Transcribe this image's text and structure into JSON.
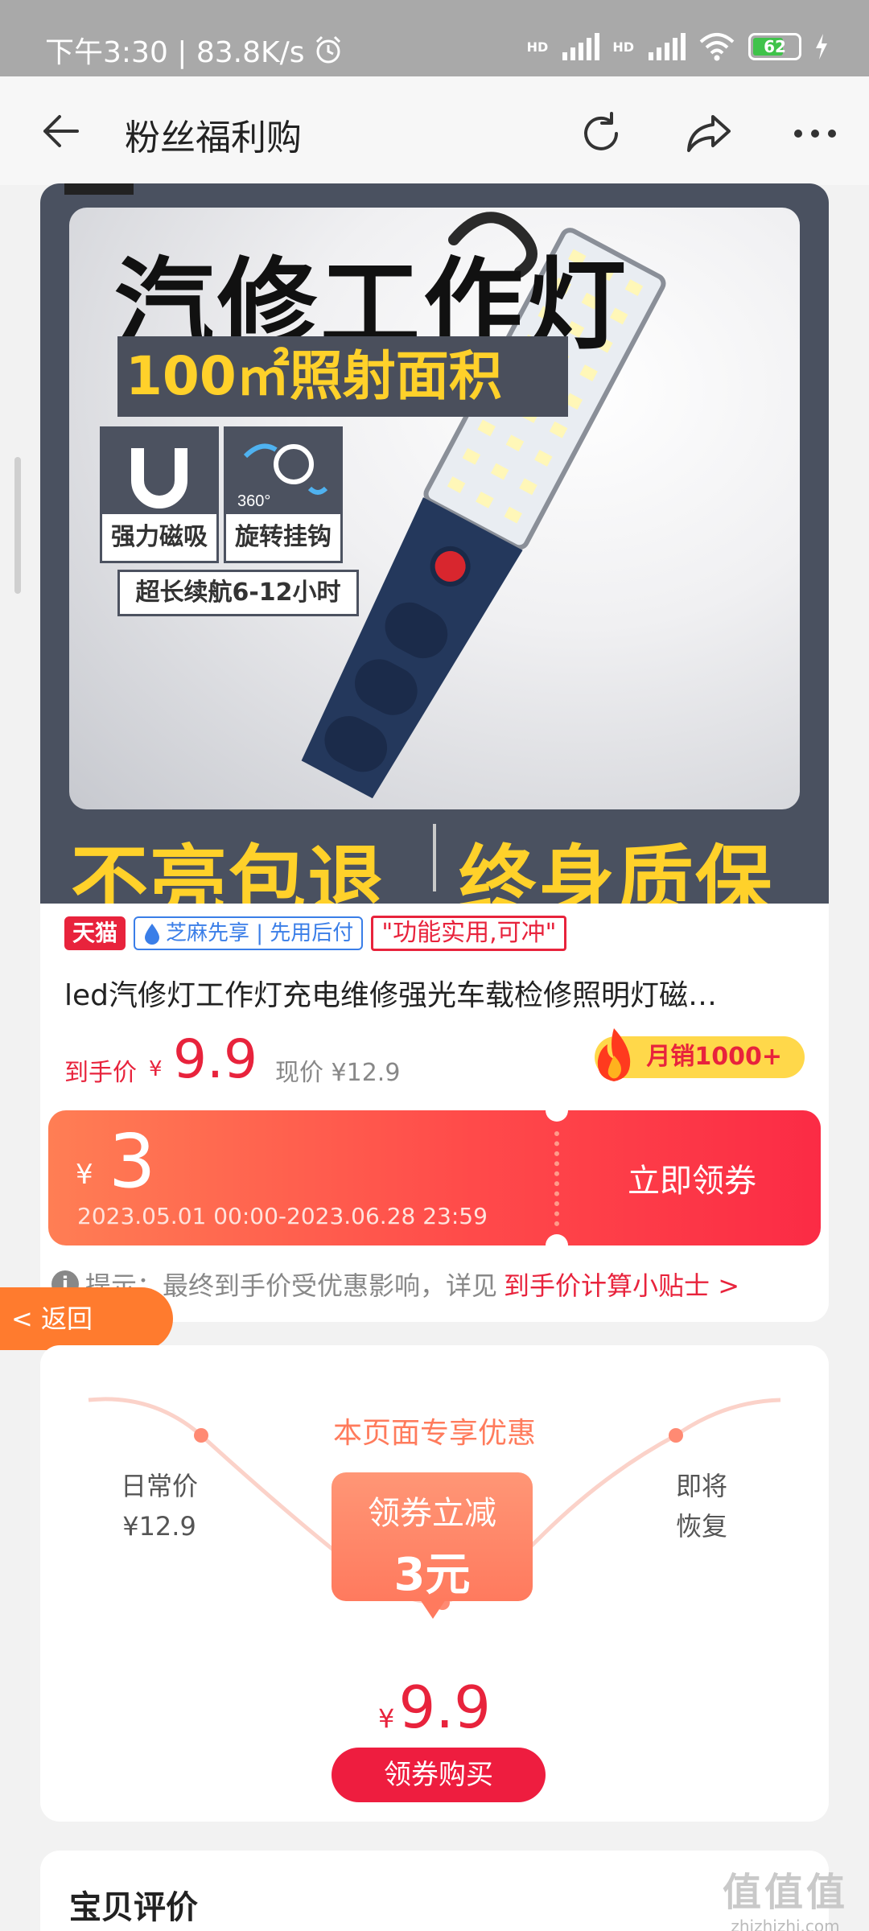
{
  "status_bar": {
    "time_speed": "下午3:30 | 83.8K/s",
    "hd1": "HD",
    "hd2": "HD",
    "battery": "62"
  },
  "header": {
    "title": "粉丝福利购"
  },
  "banner": {
    "title": "汽修工作灯",
    "subtitle": "100㎡照射面积",
    "feature1": "强力磁吸",
    "feature2": "旋转挂钩",
    "rotate_label": "360°",
    "battery_life": "超长续航6-12小时",
    "guarantee_left": "不亮包退",
    "guarantee_right": "终身质保"
  },
  "tags": {
    "tmall": "天猫",
    "zhima": "芝麻先享 | 先用后付",
    "slogan": "\"功能实用,可冲\""
  },
  "product": {
    "title": "led汽修灯工作灯充电维修强光车载检修照明灯磁…",
    "final_price_label": "到手价",
    "final_price_currency": "¥",
    "final_price": "9.9",
    "current_price": "现价 ¥12.9",
    "monthly_sales": "月销1000+"
  },
  "coupon": {
    "currency": "¥",
    "amount": "3",
    "validity": "2023.05.01 00:00-2023.06.28 23:59",
    "action": "立即领券"
  },
  "tip": {
    "prefix": "提示：最终到手价受优惠影响，详见",
    "link": "到手价计算小贴士 >"
  },
  "float_back": "< 返回",
  "promo": {
    "title": "本页面专享优惠",
    "daily_label": "日常价",
    "daily_price": "¥12.9",
    "restore_line1": "即将",
    "restore_line2": "恢复",
    "bubble_line1": "领券立减",
    "bubble_line2": "3元",
    "final_currency": "¥",
    "final_price": "9.9",
    "buy_button": "领券购买"
  },
  "review": {
    "title": "宝贝评价"
  },
  "watermark": {
    "logo": "值值值",
    "site": "zhizhizhi.com"
  },
  "colors": {
    "accent_red": "#e8233c",
    "coupon_orange": "#ff7e54",
    "banner_dark": "#4a5160",
    "banner_yellow": "#ffd12a"
  }
}
